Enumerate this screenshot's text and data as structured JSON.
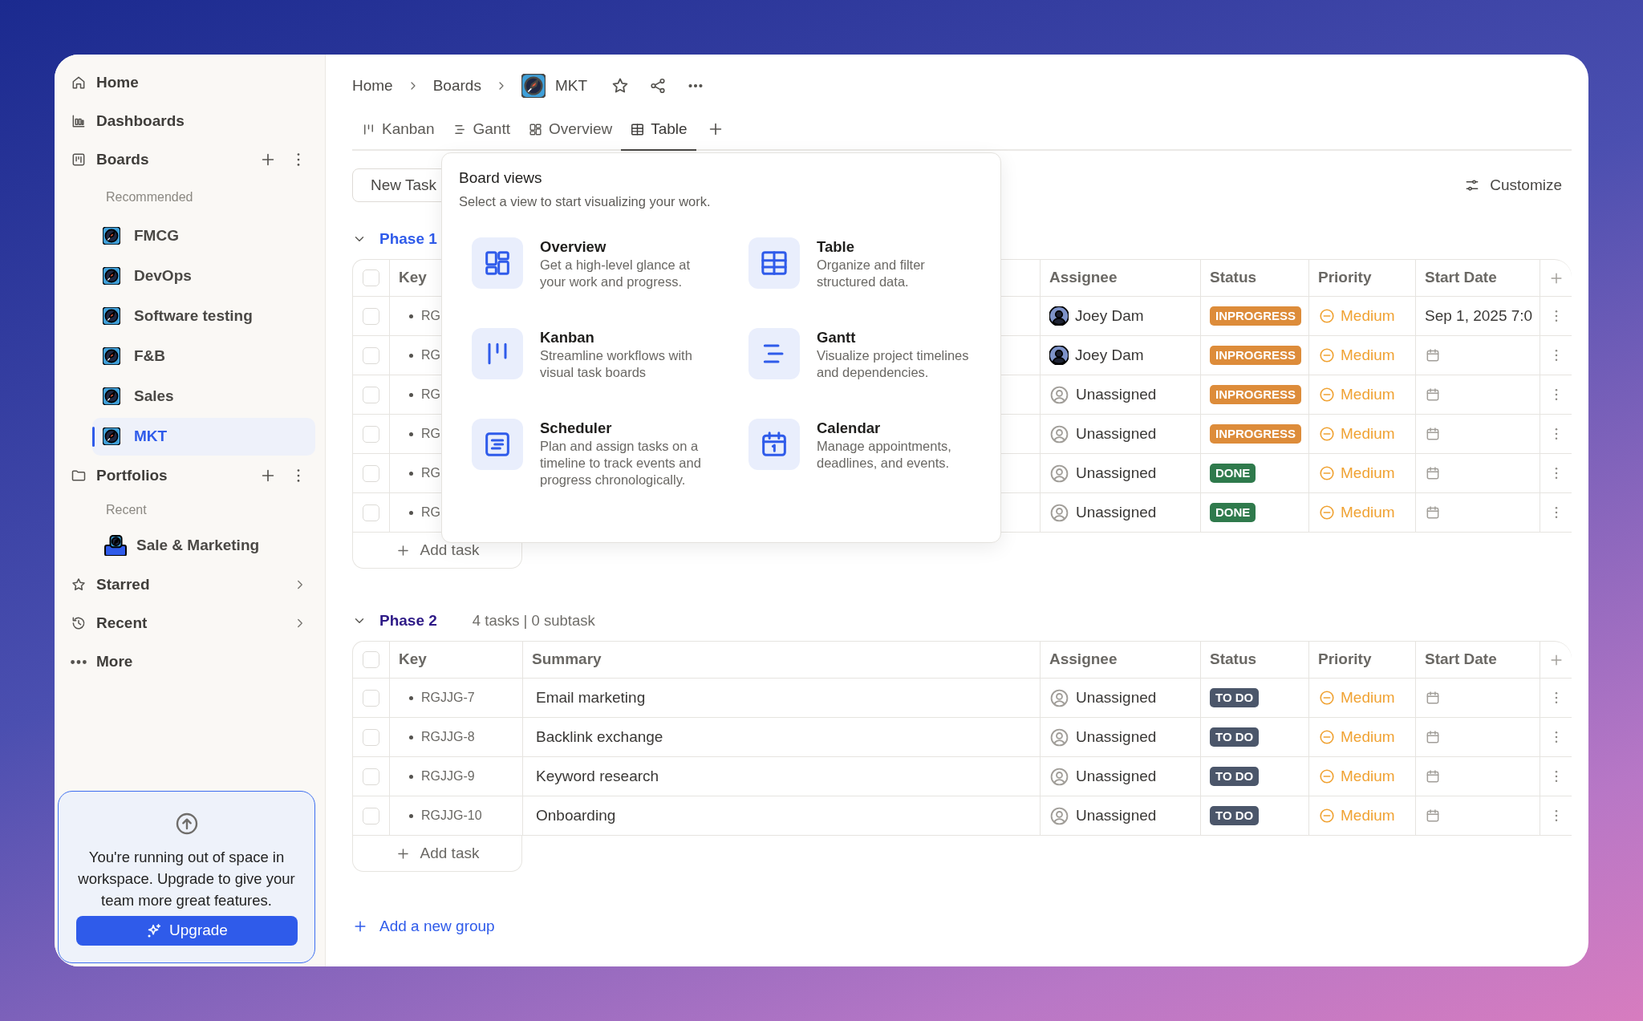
{
  "sidebar": {
    "nav": [
      {
        "label": "Home"
      },
      {
        "label": "Dashboards"
      }
    ],
    "boards": {
      "label": "Boards",
      "caption": "Recommended",
      "items": [
        {
          "name": "FMCG",
          "selected": false
        },
        {
          "name": "DevOps",
          "selected": false
        },
        {
          "name": "Software testing",
          "selected": false
        },
        {
          "name": "F&B",
          "selected": false
        },
        {
          "name": "Sales",
          "selected": false
        },
        {
          "name": "MKT",
          "selected": true
        }
      ]
    },
    "portfolios": {
      "label": "Portfolios",
      "caption": "Recent",
      "items": [
        {
          "name": "Sale & Marketing"
        }
      ]
    },
    "more_nav": [
      {
        "label": "Starred",
        "expandable": true
      },
      {
        "label": "Recent",
        "expandable": true
      },
      {
        "label": "More",
        "expandable": false
      }
    ],
    "upgrade": {
      "message": "You're running out of space in workspace. Upgrade to give your team more great features.",
      "button": "Upgrade"
    }
  },
  "breadcrumb": [
    "Home",
    "Boards",
    "MKT"
  ],
  "tabs": [
    {
      "label": "Kanban",
      "selected": false
    },
    {
      "label": "Gantt",
      "selected": false
    },
    {
      "label": "Overview",
      "selected": false
    },
    {
      "label": "Table",
      "selected": true
    }
  ],
  "toolbar": {
    "new_task": "New Task",
    "customize": "Customize"
  },
  "groups": [
    {
      "name": "Phase 1",
      "color": "#2f5bea",
      "checked": false,
      "columns": {
        "key": "Key",
        "assignee": "Assignee",
        "status": "Status",
        "priority": "Priority",
        "start_date": "Start Date"
      },
      "rows": [
        {
          "key": "RG",
          "checked": false,
          "assignee": {
            "name": "Joey Dam",
            "kind": "person"
          },
          "status": {
            "label": "INPROGRESS",
            "kind": "inprogress"
          },
          "priority": "Medium",
          "start_date": "Sep 1, 2025 7:0"
        },
        {
          "key": "RG",
          "checked": false,
          "assignee": {
            "name": "Joey Dam",
            "kind": "person"
          },
          "status": {
            "label": "INPROGRESS",
            "kind": "inprogress"
          },
          "priority": "Medium"
        },
        {
          "key": "RG",
          "checked": false,
          "assignee": {
            "name": "Unassigned",
            "kind": "none"
          },
          "status": {
            "label": "INPROGRESS",
            "kind": "inprogress"
          },
          "priority": "Medium"
        },
        {
          "key": "RG",
          "checked": false,
          "assignee": {
            "name": "Unassigned",
            "kind": "none"
          },
          "status": {
            "label": "INPROGRESS",
            "kind": "inprogress"
          },
          "priority": "Medium"
        },
        {
          "key": "RG",
          "checked": false,
          "assignee": {
            "name": "Unassigned",
            "kind": "none"
          },
          "status": {
            "label": "DONE",
            "kind": "done"
          },
          "priority": "Medium"
        },
        {
          "key": "RG",
          "checked": false,
          "assignee": {
            "name": "Unassigned",
            "kind": "none"
          },
          "status": {
            "label": "DONE",
            "kind": "done"
          },
          "priority": "Medium"
        }
      ],
      "add_task": "Add task"
    },
    {
      "name": "Phase 2",
      "color": "#2e1a87",
      "meta": "4 tasks | 0 subtask",
      "checked": false,
      "columns": {
        "key": "Key",
        "summary": "Summary",
        "assignee": "Assignee",
        "status": "Status",
        "priority": "Priority",
        "start_date": "Start Date"
      },
      "rows": [
        {
          "key": "RGJJG-7",
          "summary": "Email marketing",
          "checked": false,
          "assignee": {
            "name": "Unassigned",
            "kind": "none"
          },
          "status": {
            "label": "TO DO",
            "kind": "todo"
          },
          "priority": "Medium"
        },
        {
          "key": "RGJJG-8",
          "summary": "Backlink exchange",
          "checked": false,
          "assignee": {
            "name": "Unassigned",
            "kind": "none"
          },
          "status": {
            "label": "TO DO",
            "kind": "todo"
          },
          "priority": "Medium"
        },
        {
          "key": "RGJJG-9",
          "summary": "Keyword research",
          "checked": false,
          "assignee": {
            "name": "Unassigned",
            "kind": "none"
          },
          "status": {
            "label": "TO DO",
            "kind": "todo"
          },
          "priority": "Medium"
        },
        {
          "key": "RGJJG-10",
          "summary": "Onboarding",
          "checked": false,
          "assignee": {
            "name": "Unassigned",
            "kind": "none"
          },
          "status": {
            "label": "TO DO",
            "kind": "todo"
          },
          "priority": "Medium"
        }
      ],
      "add_task": "Add task"
    }
  ],
  "add_group": "Add a new group",
  "board_views": {
    "title": "Board views",
    "subtitle": "Select a view to start visualizing your work.",
    "options": [
      {
        "title": "Overview",
        "description": "Get a high-level glance at your work and progress."
      },
      {
        "title": "Table",
        "description": "Organize and filter structured data."
      },
      {
        "title": "Kanban",
        "description": "Streamline workflows with visual task boards"
      },
      {
        "title": "Gantt",
        "description": "Visualize project timelines and dependencies."
      },
      {
        "title": "Scheduler",
        "description": "Plan and assign tasks on a timeline to track events and progress chronologically."
      },
      {
        "title": "Calendar",
        "description": "Manage appointments, deadlines, and events."
      }
    ]
  }
}
